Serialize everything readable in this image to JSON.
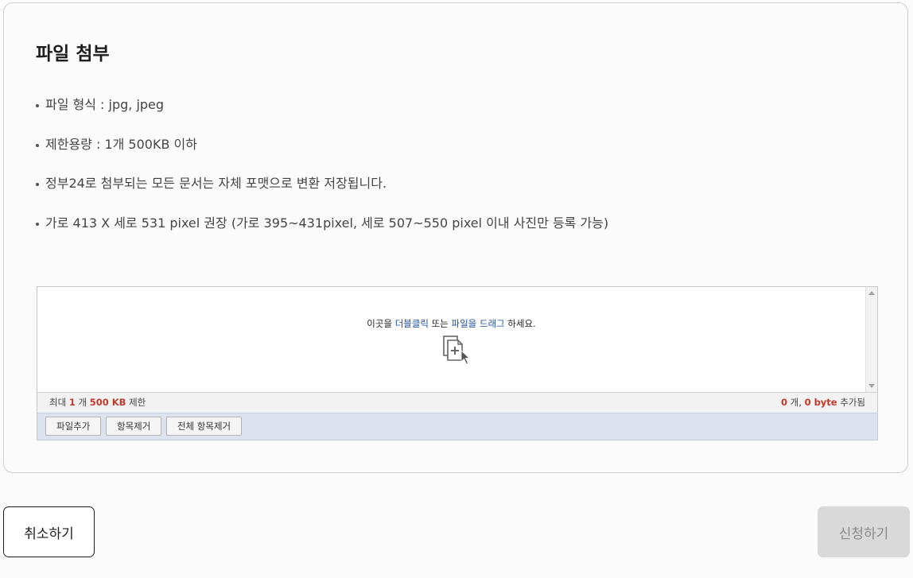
{
  "card": {
    "title": "파일 첨부",
    "info_items": [
      "파일 형식 : jpg, jpeg",
      "제한용량 : 1개 500KB 이하",
      "정부24로 첨부되는 모든 문서는 자체 포맷으로 변환 저장됩니다.",
      "가로 413 X 세로 531 pixel 권장 (가로 395~431pixel, 세로 507~550 pixel 이내 사진만 등록 가능)"
    ]
  },
  "uploader": {
    "drop_text": {
      "part1": "이곳을 ",
      "link1": "더블클릭",
      "part2": " 또는 ",
      "link2": "파일을 드래그",
      "part3": " 하세요."
    },
    "drop_icon": "file-add-cursor-icon",
    "status": {
      "max_label": "최대",
      "max_count": "1",
      "count_unit": "개",
      "max_size": "500 KB",
      "limit_label": "제한",
      "added_count": "0",
      "added_count_unit": "개,",
      "added_bytes": "0 byte",
      "added_label": "추가됨"
    },
    "buttons": {
      "add_file": "파일추가",
      "remove_item": "항목제거",
      "remove_all": "전체 항목제거"
    }
  },
  "actions": {
    "cancel": "취소하기",
    "submit": "신청하기"
  },
  "colors": {
    "highlight_text": "#1f4f9c",
    "status_number": "#c0392b",
    "button_bar_bg": "#dde3ee",
    "disabled_button_bg": "#d9d9d9"
  }
}
